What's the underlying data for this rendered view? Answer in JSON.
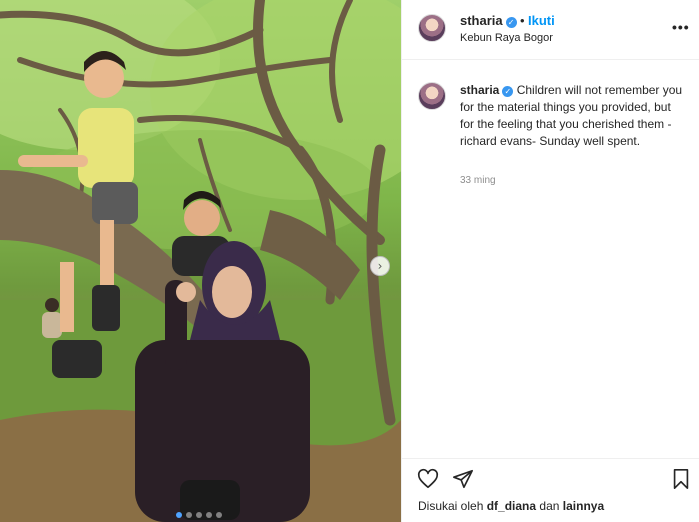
{
  "post": {
    "username": "stharia",
    "follow_label": "Ikuti",
    "separator": "•",
    "location": "Kebun Raya Bogor",
    "more_label": "•••",
    "caption_text": "Children will not remember you for the material things you provided, but for the feeling that you cherished them -richard evans- Sunday well spent.",
    "time": "33 ming",
    "likes_prefix": "Disukai oleh",
    "likes_user": "df_diana",
    "likes_mid": "dan",
    "likes_suffix": "lainnya"
  },
  "icons": {
    "verified": "verified-badge",
    "like": "heart-icon",
    "share": "send-icon",
    "save": "bookmark-icon",
    "next": "chevron-right-icon"
  },
  "colors": {
    "accent": "#0095f6",
    "verified": "#3897f0",
    "muted": "#8e8e8e",
    "border": "#efefef"
  },
  "carousel": {
    "next_glyph": "›",
    "total_slides": 5,
    "active_slide": 1
  }
}
